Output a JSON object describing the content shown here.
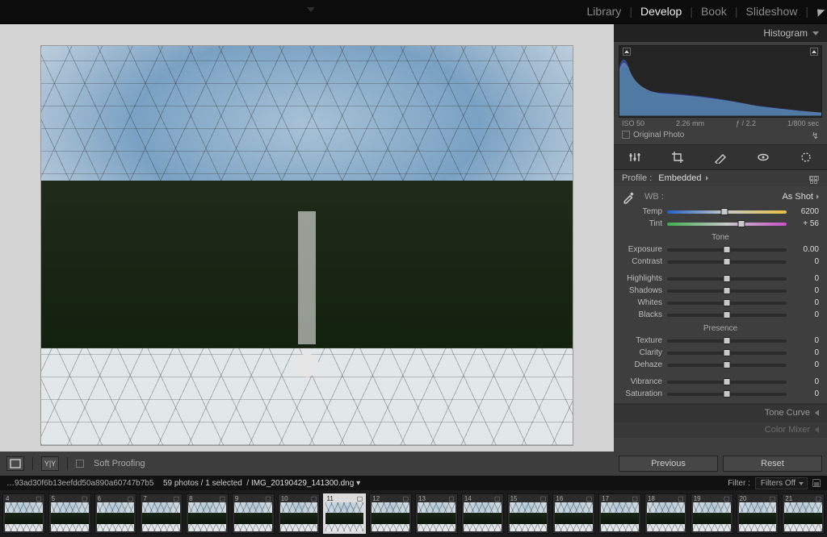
{
  "modules": {
    "library": "Library",
    "develop": "Develop",
    "book": "Book",
    "slideshow": "Slideshow"
  },
  "histogram": {
    "title": "Histogram",
    "iso": "ISO 50",
    "focal": "2.26 mm",
    "aperture": "ƒ / 2.2",
    "shutter": "1/800 sec",
    "original_label": "Original Photo",
    "bolt": "↯"
  },
  "profile": {
    "label": "Profile :",
    "value": "Embedded"
  },
  "wb": {
    "heading": "WB :",
    "mode": "As Shot",
    "temp": {
      "label": "Temp",
      "value": "6200",
      "pos": 48
    },
    "tint": {
      "label": "Tint",
      "value": "+ 56",
      "pos": 62
    }
  },
  "tone": {
    "heading": "Tone",
    "exposure": {
      "label": "Exposure",
      "value": "0.00",
      "pos": 50
    },
    "contrast": {
      "label": "Contrast",
      "value": "0",
      "pos": 50
    },
    "highlights": {
      "label": "Highlights",
      "value": "0",
      "pos": 50
    },
    "shadows": {
      "label": "Shadows",
      "value": "0",
      "pos": 50
    },
    "whites": {
      "label": "Whites",
      "value": "0",
      "pos": 50
    },
    "blacks": {
      "label": "Blacks",
      "value": "0",
      "pos": 50
    }
  },
  "presence": {
    "heading": "Presence",
    "texture": {
      "label": "Texture",
      "value": "0",
      "pos": 50
    },
    "clarity": {
      "label": "Clarity",
      "value": "0",
      "pos": 50
    },
    "dehaze": {
      "label": "Dehaze",
      "value": "0",
      "pos": 50
    },
    "vibrance": {
      "label": "Vibrance",
      "value": "0",
      "pos": 50
    },
    "saturation": {
      "label": "Saturation",
      "value": "0",
      "pos": 50
    }
  },
  "closed_panels": {
    "tone_curve": "Tone Curve",
    "color_mixer": "Color Mixer"
  },
  "toolbar": {
    "yy": "Y|Y",
    "soft_proof": "Soft Proofing"
  },
  "buttons": {
    "previous": "Previous",
    "reset": "Reset"
  },
  "status": {
    "hash": "…93ad30f6b13eefdd50a890a60747b7b5",
    "count": "59 photos / 1 selected",
    "file": "IMG_20190429_141300.dng",
    "filter_label": "Filter :",
    "filter_value": "Filters Off"
  },
  "filmstrip": {
    "start": 4,
    "count": 18,
    "selected": 11
  }
}
